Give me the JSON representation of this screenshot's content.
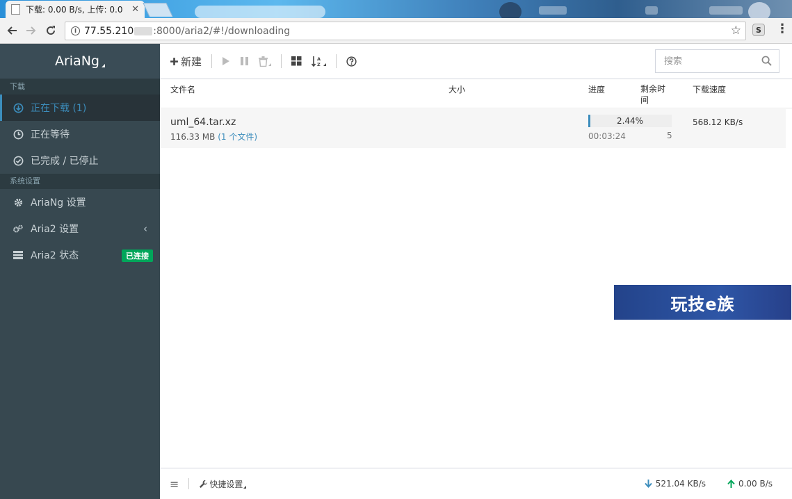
{
  "browser": {
    "tab_title": "下载: 0.00 B/s, 上传: 0.0",
    "close_glyph": "✕",
    "url_host": "77.55.210",
    "url_path": ":8000/aria2/#!/downloading",
    "ext_letter": "S"
  },
  "sidebar": {
    "brand": "AriaNg",
    "section_download": "下载",
    "items": [
      {
        "label": "正在下载 (1)",
        "icon": "download-circle-icon"
      },
      {
        "label": "正在等待",
        "icon": "clock-icon"
      },
      {
        "label": "已完成 / 已停止",
        "icon": "check-circle-icon"
      }
    ],
    "section_settings": "系统设置",
    "settings_items": [
      {
        "label": "AriaNg 设置",
        "icon": "gear-icon"
      },
      {
        "label": "Aria2 设置",
        "icon": "gears-icon"
      },
      {
        "label": "Aria2 状态",
        "icon": "server-icon",
        "badge": "已连接"
      }
    ],
    "colors": {
      "bg": "#374850",
      "active": "#3c8dbc",
      "badge": "#00a65a"
    }
  },
  "toolbar": {
    "new_label": "新建",
    "search_placeholder": "搜索"
  },
  "table": {
    "headers": {
      "name": "文件名",
      "size": "大小",
      "progress": "进度",
      "remaining": "剩余时间",
      "speed": "下载速度"
    },
    "rows": [
      {
        "name": "uml_64.tar.xz",
        "size": "116.33 MB",
        "files": "(1 个文件)",
        "progress_pct": "2.44%",
        "progress_value": 2.44,
        "elapsed": "00:03:24",
        "connections": "5",
        "speed": "568.12 KB/s"
      }
    ]
  },
  "watermark": "玩技e族",
  "footer": {
    "quick_settings": "快捷设置",
    "download_speed": "521.04 KB/s",
    "upload_speed": "0.00 B/s"
  }
}
